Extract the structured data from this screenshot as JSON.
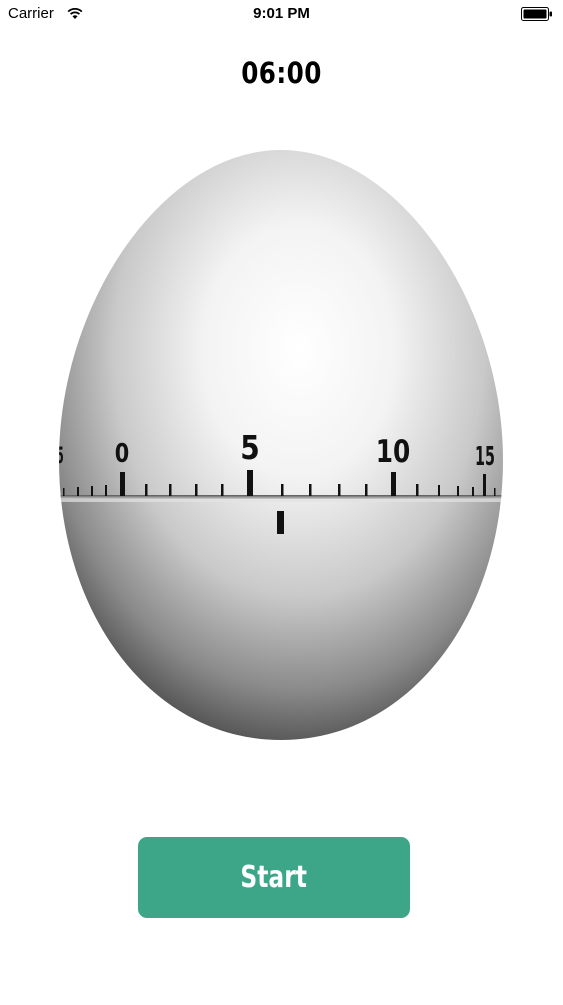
{
  "status_bar": {
    "carrier": "Carrier",
    "time": "9:01 PM",
    "wifi_icon": "wifi-icon",
    "battery_icon": "battery-icon"
  },
  "timer": {
    "display": "06:00",
    "dial_labels": [
      "5",
      "0",
      "5",
      "10",
      "15"
    ],
    "pointer_icon": "indicator-mark"
  },
  "controls": {
    "start_label": "Start",
    "start_color": "#3ea688"
  }
}
